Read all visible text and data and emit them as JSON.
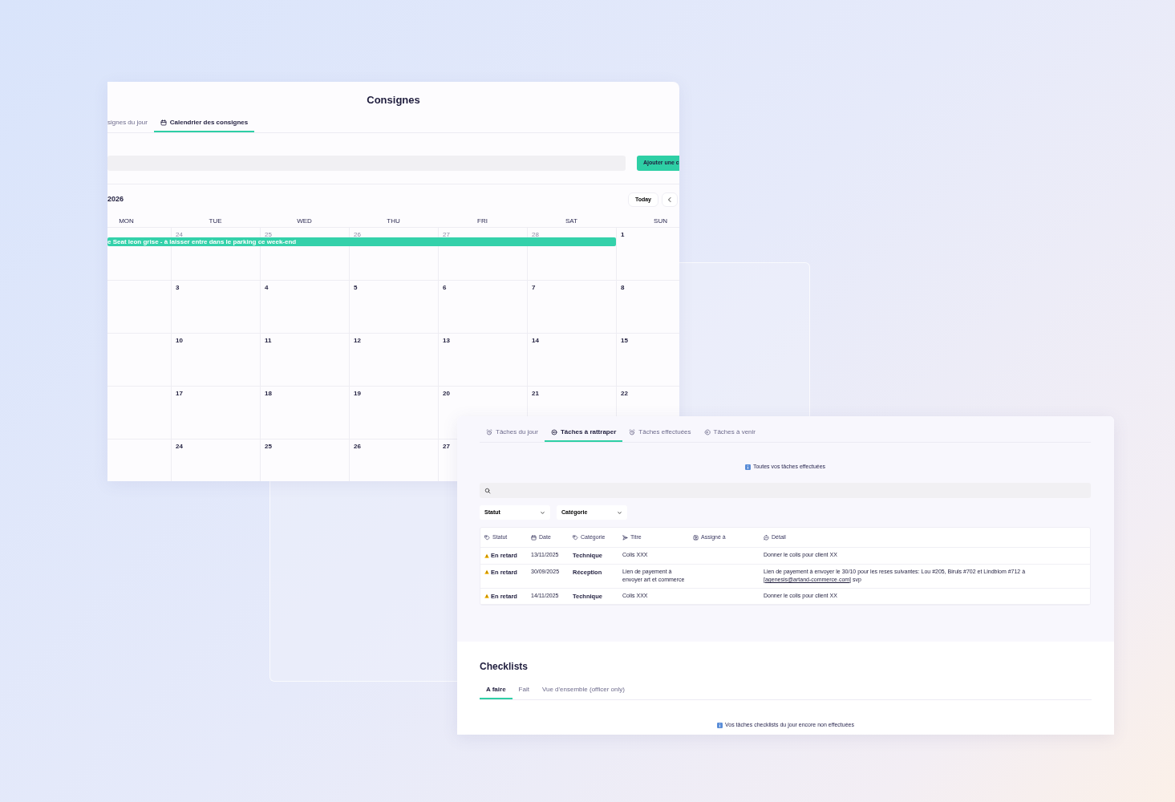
{
  "calendar_window": {
    "title": "Consignes",
    "tabs": [
      {
        "label": "signes du jour",
        "selected": false
      },
      {
        "label": "Calendrier des consignes",
        "selected": true
      }
    ],
    "add_button": "Ajouter une c",
    "month_label": "2026",
    "today_button": "Today",
    "weekdays": [
      "MON",
      "TUE",
      "WED",
      "THU",
      "FRI",
      "SAT",
      "SUN"
    ],
    "weeks": [
      {
        "days": [
          {
            "number": "24",
            "muted": true
          },
          {
            "number": "25",
            "muted": true
          },
          {
            "number": "26",
            "muted": true
          },
          {
            "number": "27",
            "muted": true
          },
          {
            "number": "28",
            "muted": true
          },
          {
            "number": "1",
            "muted": false
          }
        ]
      },
      {
        "days": [
          {
            "number": "3",
            "muted": false
          },
          {
            "number": "4",
            "muted": false
          },
          {
            "number": "5",
            "muted": false
          },
          {
            "number": "6",
            "muted": false
          },
          {
            "number": "7",
            "muted": false
          },
          {
            "number": "8",
            "muted": false
          }
        ]
      },
      {
        "days": [
          {
            "number": "10",
            "muted": false
          },
          {
            "number": "11",
            "muted": false
          },
          {
            "number": "12",
            "muted": false
          },
          {
            "number": "13",
            "muted": false
          },
          {
            "number": "14",
            "muted": false
          },
          {
            "number": "15",
            "muted": false
          }
        ]
      },
      {
        "days": [
          {
            "number": "17",
            "muted": false
          },
          {
            "number": "18",
            "muted": false
          },
          {
            "number": "19",
            "muted": false
          },
          {
            "number": "20",
            "muted": false
          },
          {
            "number": "21",
            "muted": false
          },
          {
            "number": "22",
            "muted": false
          }
        ]
      },
      {
        "days": [
          {
            "number": "24",
            "muted": false
          },
          {
            "number": "25",
            "muted": false
          },
          {
            "number": "26",
            "muted": false
          },
          {
            "number": "27",
            "muted": false
          }
        ]
      }
    ],
    "event": {
      "label": "e Seat leon grise - à laisser entre dans le parking ce week-end",
      "color": "#34d1aa"
    }
  },
  "tasks_window": {
    "tabs": [
      {
        "label": "Tâches du jour",
        "selected": false
      },
      {
        "label": "Tâches à rattraper",
        "selected": true
      },
      {
        "label": "Tâches effectuées",
        "selected": false
      },
      {
        "label": "Tâches à venir",
        "selected": false
      }
    ],
    "notice": "Toutes vos tâches effectuées",
    "filters": [
      "Statut",
      "Catégorie"
    ],
    "table": {
      "columns": [
        "Statut",
        "Date",
        "Catégorie",
        "Titre",
        "Assigné à",
        "Détail"
      ],
      "rows": [
        {
          "status": "En retard",
          "date": "13/11/2025",
          "category": "Technique",
          "title": "Colis XXX",
          "detail": "Donner le colis pour client XX"
        },
        {
          "status": "En retard",
          "date": "30/09/2025",
          "category": "Réception",
          "title": "Lien de payement à envoyer art et commerce",
          "detail": "Lien de payement à envoyer le 30/10 pour les reses suivantes: Lou #205, Biruls #702 et Lindblom #712 à [",
          "detail_link": "agenesis@artand-commerce.com",
          "detail_suffix": "] svp"
        },
        {
          "status": "En retard",
          "date": "14/11/2025",
          "category": "Technique",
          "title": "Colis XXX",
          "detail": "Donner le colis pour client XX"
        }
      ]
    }
  },
  "checklists": {
    "title": "Checklists",
    "tabs": [
      {
        "label": "A faire",
        "selected": true
      },
      {
        "label": "Fait",
        "selected": false
      },
      {
        "label": "Vue d'ensemble (officer only)",
        "selected": false
      }
    ],
    "notice": "Vos tâches checklists du jour encore non effectuées"
  }
}
